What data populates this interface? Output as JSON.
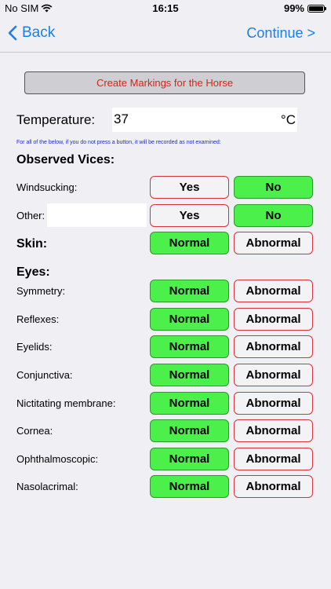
{
  "status": {
    "carrier": "No SIM",
    "time": "16:15",
    "battery": "99%",
    "battery_level": 0.99
  },
  "nav": {
    "back_label": "Back",
    "continue_label": "Continue >"
  },
  "markings_button": "Create Markings for the Horse",
  "temperature": {
    "label": "Temperature:",
    "value": "37",
    "unit": "°C"
  },
  "note": "For all of the below, if you do not press a button, it will be recorded as not examined:",
  "vices": {
    "heading": "Observed Vices:",
    "windsucking": {
      "label": "Windsucking:",
      "yes": "Yes",
      "no": "No",
      "selected": "No"
    },
    "other": {
      "label": "Other:",
      "value": "",
      "yes": "Yes",
      "no": "No",
      "selected": "No"
    }
  },
  "skin": {
    "label": "Skin:",
    "normal": "Normal",
    "abnormal": "Abnormal",
    "selected": "Normal"
  },
  "eyes": {
    "heading": "Eyes:",
    "rows": [
      {
        "label": "Symmetry:",
        "normal": "Normal",
        "abnormal": "Abnormal",
        "selected": "Normal"
      },
      {
        "label": "Reflexes:",
        "normal": "Normal",
        "abnormal": "Abnormal",
        "selected": "Normal"
      },
      {
        "label": "Eyelids:",
        "normal": "Normal",
        "abnormal": "Abnormal",
        "selected": "Normal"
      },
      {
        "label": "Conjunctiva:",
        "normal": "Normal",
        "abnormal": "Abnormal",
        "selected": "Normal"
      },
      {
        "label": "Nictitating membrane:",
        "normal": "Normal",
        "abnormal": "Abnormal",
        "selected": "Normal"
      },
      {
        "label": "Cornea:",
        "normal": "Normal",
        "abnormal": "Abnormal",
        "selected": "Normal"
      },
      {
        "label": "Ophthalmoscopic:",
        "normal": "Normal",
        "abnormal": "Abnormal",
        "selected": "Normal"
      },
      {
        "label": "Nasolacrimal:",
        "normal": "Normal",
        "abnormal": "Abnormal",
        "selected": "Normal"
      }
    ]
  },
  "colors": {
    "accent": "#1d7ee8",
    "selected_fill": "#4cf04a",
    "unselected_border": "#d8323a",
    "markings_text": "#e0201a",
    "note_text": "#1e2ad8"
  }
}
